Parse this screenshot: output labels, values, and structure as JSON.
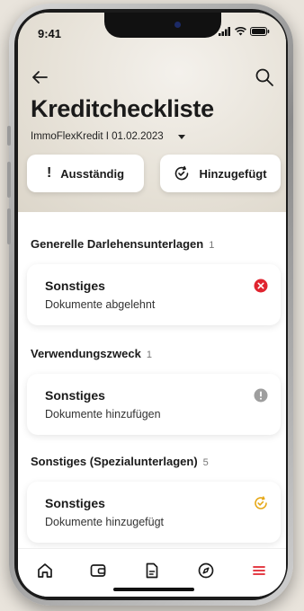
{
  "status_bar": {
    "time": "9:41"
  },
  "header": {
    "title": "Kreditcheckliste",
    "subtitle": "ImmoFlexKredit I 01.02.2023"
  },
  "filters": {
    "open_label": "Ausständig",
    "added_label": "Hinzugefügt"
  },
  "sections": [
    {
      "title": "Generelle Darlehensunterlagen",
      "count": "1",
      "card": {
        "title": "Sonstiges",
        "status": "Dokumente abgelehnt",
        "icon": "error-circle-icon",
        "color": "#e0242f"
      }
    },
    {
      "title": "Verwendungszweck",
      "count": "1",
      "card": {
        "title": "Sonstiges",
        "status": "Dokumente hinzufügen",
        "icon": "info-circle-icon",
        "color": "#9e9e9e"
      }
    },
    {
      "title": "Sonstiges (Spezialunterlagen)",
      "count": "5",
      "card": {
        "title": "Sonstiges",
        "status": "Dokumente hinzugefügt",
        "icon": "pending-clock-icon",
        "color": "#e6a817"
      }
    }
  ],
  "bottom_nav": [
    "home-icon",
    "wallet-icon",
    "document-icon",
    "compass-icon",
    "menu-icon"
  ],
  "colors": {
    "accent": "#e0242f"
  }
}
